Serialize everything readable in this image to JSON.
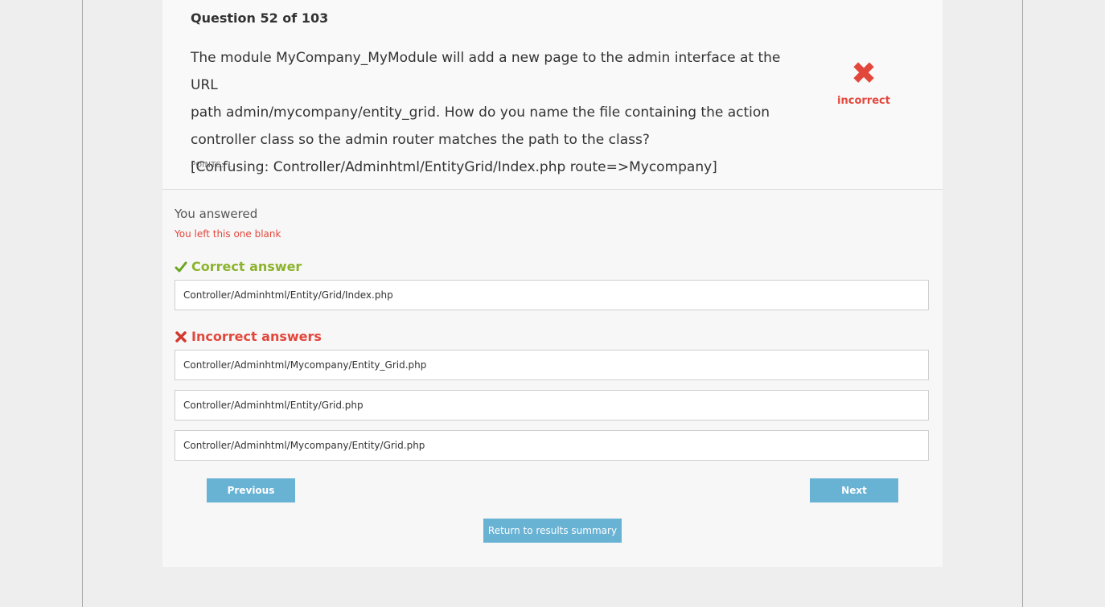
{
  "question": {
    "number_label": "Question 52 of 103",
    "text_lines": [
      "The module MyCompany_MyModule will add a new page to the admin interface at the URL",
      "path admin/mycompany/entity_grid. How do you name the file containing the action",
      "controller class so the admin router matches the path to the class?",
      "[Confusing: Controller/Adminhtml/EntityGrid/Index.php route=>Mycompany]"
    ],
    "points": "POINTS: 1",
    "status": "incorrect"
  },
  "you_answered": {
    "heading": "You answered",
    "value": "You left this one blank"
  },
  "correct": {
    "heading": "Correct answer",
    "answers": [
      "Controller/Adminhtml/Entity/Grid/Index.php"
    ]
  },
  "incorrect": {
    "heading": "Incorrect answers",
    "answers": [
      "Controller/Adminhtml/Mycompany/Entity_Grid.php",
      "Controller/Adminhtml/Entity/Grid.php",
      "Controller/Adminhtml/Mycompany/Entity/Grid.php"
    ]
  },
  "nav": {
    "previous": "Previous",
    "next": "Next",
    "return": "Return to results summary"
  },
  "colors": {
    "correct": "#8cb32c",
    "incorrect": "#e2473c",
    "button": "#68b2d4"
  }
}
